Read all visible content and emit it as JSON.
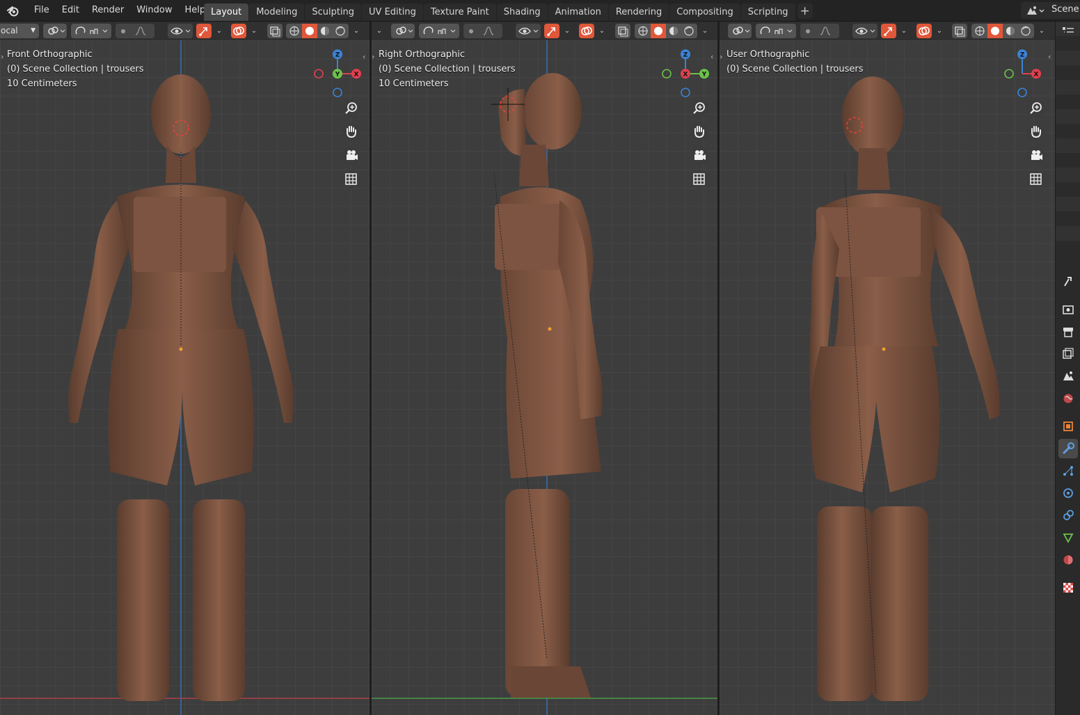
{
  "menu": [
    "File",
    "Edit",
    "Render",
    "Window",
    "Help"
  ],
  "workspaces": [
    {
      "label": "Layout",
      "active": true
    },
    {
      "label": "Modeling",
      "active": false
    },
    {
      "label": "Sculpting",
      "active": false
    },
    {
      "label": "UV Editing",
      "active": false
    },
    {
      "label": "Texture Paint",
      "active": false
    },
    {
      "label": "Shading",
      "active": false
    },
    {
      "label": "Animation",
      "active": false
    },
    {
      "label": "Rendering",
      "active": false
    },
    {
      "label": "Compositing",
      "active": false
    },
    {
      "label": "Scripting",
      "active": false
    }
  ],
  "add_workspace": "+",
  "scene": {
    "label": "Scene"
  },
  "toolbar": {
    "transform_orientation": "ocal"
  },
  "viewports": [
    {
      "view": "Front Orthographic",
      "collection": "(0) Scene Collection | trousers",
      "scale": "10 Centimeters",
      "gizmo": {
        "top": "Z",
        "center": "Y",
        "right": "X"
      }
    },
    {
      "view": "Right Orthographic",
      "collection": "(0) Scene Collection | trousers",
      "scale": "10 Centimeters",
      "gizmo": {
        "top": "Z",
        "center": "X",
        "right": "Y"
      }
    },
    {
      "view": "User Orthographic",
      "collection": "(0) Scene Collection | trousers",
      "gizmo": {
        "top": "Z",
        "center": "",
        "right": "X"
      }
    }
  ],
  "colors": {
    "accent_active_tool": "#e0573a",
    "axis_x": "#e0404f",
    "axis_y": "#6cc24a",
    "axis_z": "#3b83d6",
    "model_skin": "#8a5e48"
  },
  "properties_tabs": [
    "tool-icon",
    "render-icon",
    "output-icon",
    "view-layer-icon",
    "scene-icon",
    "world-icon",
    "object-icon",
    "modifier-icon",
    "particles-icon",
    "physics-icon",
    "constraints-icon",
    "data-icon",
    "material-icon",
    "texture-icon"
  ]
}
